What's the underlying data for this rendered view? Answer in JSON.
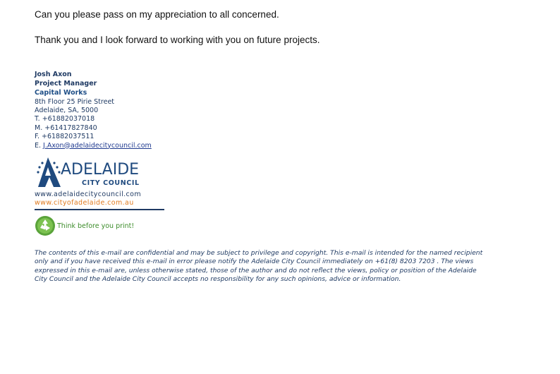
{
  "email": {
    "body_lines": [
      "Can you please pass on my appreciation to all concerned.",
      "Thank you and I look forward to working with you on future projects."
    ]
  },
  "signature": {
    "name": "Josh Axon",
    "title": "Project Manager",
    "department": "Capital Works",
    "address_line1": "8th Floor 25 Pirie Street",
    "address_line2": "Adelaide, SA, 5000",
    "phone": "T. +61882037018",
    "mobile": "M. +61417827840",
    "fax": "F. +61882037511",
    "email_prefix": "E. ",
    "email": "J.Axon@adelaidecitycouncil.com"
  },
  "logo": {
    "wordmark": "ADELAIDE",
    "subtitle": "CITY COUNCIL",
    "brand_color": "#1f4a7f"
  },
  "links": {
    "website1": "www.adelaidecitycouncil.com",
    "website2": "www.cityofadelaide.com.au",
    "website2_color": "#e07b20"
  },
  "eco": {
    "icon": "recycle-icon",
    "text": "Think before you print!",
    "color": "#3c8c2a"
  },
  "disclaimer": {
    "lines": [
      "The contents of this e-mail are confidential and may be subject to privilege and copyright. This e-mail is intended for the named recipient",
      "only and if you have received this e-mail in error please notify the Adelaide City Council immediately on +61(8) 8203 7203 . The views",
      "expressed in this e-mail are, unless otherwise stated, those of the author and do not reflect the views, policy or position of the Adelaide",
      "City Council and the Adelaide City Council accepts no responsibility for any such opinions, advice or information."
    ]
  }
}
